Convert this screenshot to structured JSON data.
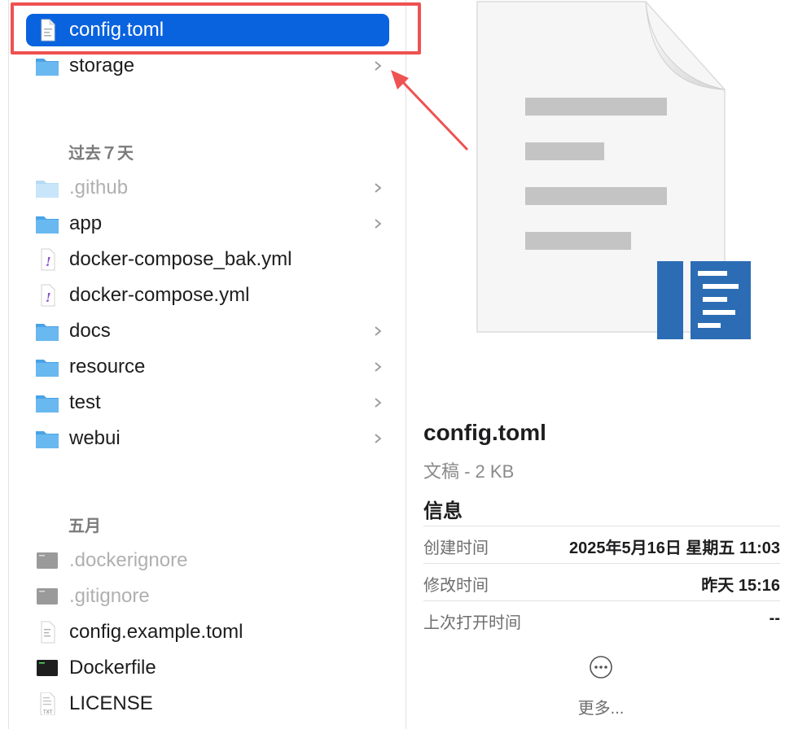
{
  "file_list": {
    "top_items": [
      {
        "label": "config.toml",
        "kind": "document",
        "selected": true
      },
      {
        "label": "storage",
        "kind": "folder",
        "has_children": true
      }
    ],
    "sections": [
      {
        "header": "过去７天",
        "items": [
          {
            "label": ".github",
            "kind": "folder",
            "dimmed": true,
            "has_children": true
          },
          {
            "label": "app",
            "kind": "folder",
            "has_children": true
          },
          {
            "label": "docker-compose_bak.yml",
            "kind": "yaml"
          },
          {
            "label": "docker-compose.yml",
            "kind": "yaml"
          },
          {
            "label": "docs",
            "kind": "folder",
            "has_children": true
          },
          {
            "label": "resource",
            "kind": "folder",
            "has_children": true
          },
          {
            "label": "test",
            "kind": "folder",
            "has_children": true
          },
          {
            "label": "webui",
            "kind": "folder",
            "has_children": true
          }
        ]
      },
      {
        "header": "五月",
        "items": [
          {
            "label": ".dockerignore",
            "kind": "exec",
            "dimmed": true
          },
          {
            "label": ".gitignore",
            "kind": "exec",
            "dimmed": true
          },
          {
            "label": "config.example.toml",
            "kind": "text"
          },
          {
            "label": "Dockerfile",
            "kind": "exec"
          },
          {
            "label": "LICENSE",
            "kind": "txt"
          }
        ]
      }
    ]
  },
  "preview": {
    "file_name": "config.toml",
    "subtitle": "文稿 - 2 KB",
    "info_header": "信息",
    "info_rows": [
      {
        "label": "创建时间",
        "value": "2025年5月16日 星期五 11:03"
      },
      {
        "label": "修改时间",
        "value": "昨天 15:16"
      },
      {
        "label": "上次打开时间",
        "value": "--"
      }
    ],
    "more_label": "更多..."
  },
  "colors": {
    "selection": "#0a63de",
    "annotation": "#ee5252",
    "folder": "#5fb0e8"
  }
}
